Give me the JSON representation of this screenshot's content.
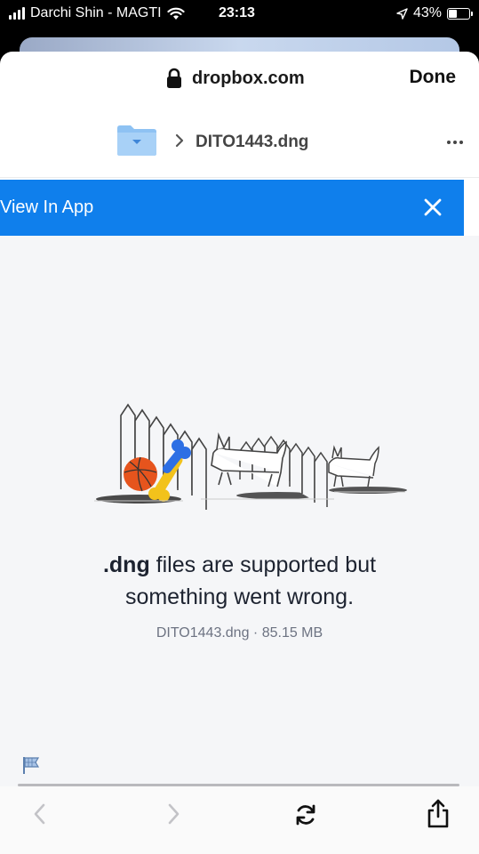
{
  "status_bar": {
    "carrier": "Darchi Shin - MAGTI",
    "time": "23:13",
    "battery_text": "43%",
    "battery_level": 0.43
  },
  "browser": {
    "url": "dropbox.com",
    "done_label": "Done"
  },
  "breadcrumb": {
    "folder_icon": "folder-icon",
    "file_name": "DITO1443.dng"
  },
  "banner": {
    "label": "View In App",
    "accent": "#0f7fec"
  },
  "error": {
    "ext": ".dng",
    "message_rest": " files are supported but",
    "message_line2": "something went wrong.",
    "file_meta": "DITO1443.dng · 85.15 MB"
  },
  "toolbar": {
    "icons": [
      "back-icon",
      "forward-icon",
      "reload-icon",
      "share-icon"
    ]
  }
}
